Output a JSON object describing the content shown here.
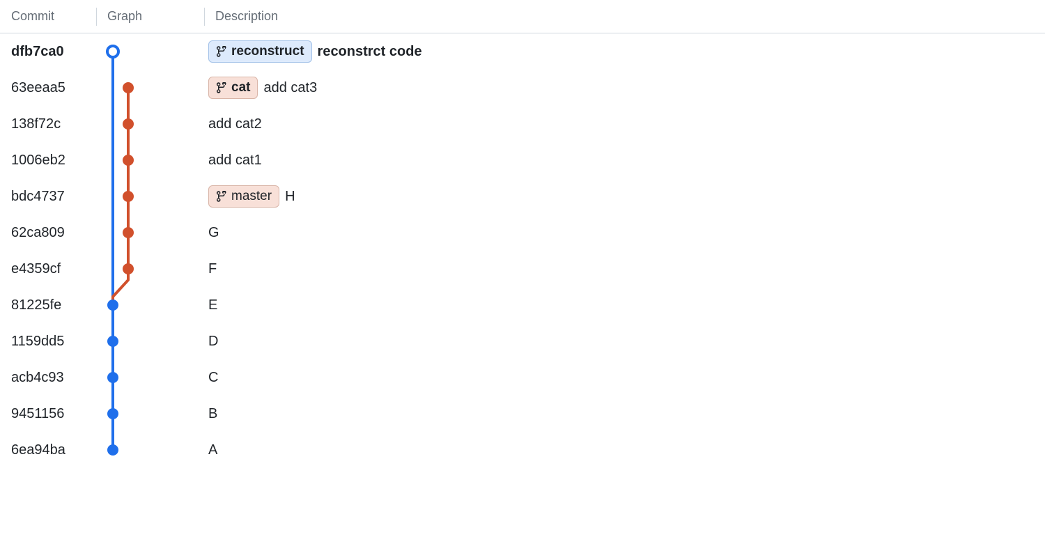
{
  "headers": {
    "commit": "Commit",
    "graph": "Graph",
    "description": "Description"
  },
  "colors": {
    "blue": "#1f6feb",
    "orange": "#d1502c"
  },
  "commits": [
    {
      "hash": "dfb7ca0",
      "bold": true,
      "branch": {
        "name": "reconstruct",
        "style": "reconstruct"
      },
      "message": "reconstrct code",
      "messageBold": true,
      "lane": 0,
      "dotStyle": "hollow-blue"
    },
    {
      "hash": "63eeaa5",
      "bold": false,
      "branch": {
        "name": "cat",
        "style": "cat"
      },
      "message": "add cat3",
      "messageBold": false,
      "lane": 1,
      "dotStyle": "solid-orange"
    },
    {
      "hash": "138f72c",
      "bold": false,
      "branch": null,
      "message": "add cat2",
      "messageBold": false,
      "lane": 1,
      "dotStyle": "solid-orange"
    },
    {
      "hash": "1006eb2",
      "bold": false,
      "branch": null,
      "message": "add cat1",
      "messageBold": false,
      "lane": 1,
      "dotStyle": "solid-orange"
    },
    {
      "hash": "bdc4737",
      "bold": false,
      "branch": {
        "name": "master",
        "style": "master"
      },
      "message": "H",
      "messageBold": false,
      "lane": 1,
      "dotStyle": "solid-orange"
    },
    {
      "hash": "62ca809",
      "bold": false,
      "branch": null,
      "message": "G",
      "messageBold": false,
      "lane": 1,
      "dotStyle": "solid-orange"
    },
    {
      "hash": "e4359cf",
      "bold": false,
      "branch": null,
      "message": "F",
      "messageBold": false,
      "lane": 1,
      "dotStyle": "solid-orange"
    },
    {
      "hash": "81225fe",
      "bold": false,
      "branch": null,
      "message": "E",
      "messageBold": false,
      "lane": 0,
      "dotStyle": "solid-blue"
    },
    {
      "hash": "1159dd5",
      "bold": false,
      "branch": null,
      "message": "D",
      "messageBold": false,
      "lane": 0,
      "dotStyle": "solid-blue"
    },
    {
      "hash": "acb4c93",
      "bold": false,
      "branch": null,
      "message": "C",
      "messageBold": false,
      "lane": 0,
      "dotStyle": "solid-blue"
    },
    {
      "hash": "9451156",
      "bold": false,
      "branch": null,
      "message": "B",
      "messageBold": false,
      "lane": 0,
      "dotStyle": "solid-blue"
    },
    {
      "hash": "6ea94ba",
      "bold": false,
      "branch": null,
      "message": "A",
      "messageBold": false,
      "lane": 0,
      "dotStyle": "solid-blue"
    }
  ]
}
